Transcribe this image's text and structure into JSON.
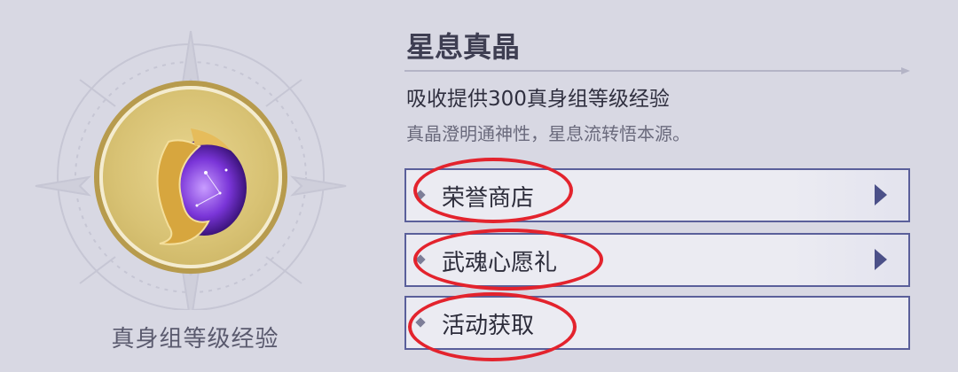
{
  "item": {
    "name": "星息真晶",
    "effect": "吸收提供300真身组等级经验",
    "flavor": "真晶澄明通神性，星息流转悟本源。",
    "caption": "真身组等级经验"
  },
  "sources": [
    {
      "label": "荣誉商店",
      "has_arrow": true
    },
    {
      "label": "武魂心愿礼",
      "has_arrow": true
    },
    {
      "label": "活动获取",
      "has_arrow": false
    }
  ],
  "colors": {
    "background": "#d8d8e3",
    "button_border": "#5a5f9a",
    "highlight_ellipse": "#e3232d"
  },
  "icons": [
    "star-compass-emblem-icon",
    "crystal-orb-icon",
    "diamond-bullet-icon",
    "play-arrow-icon"
  ]
}
